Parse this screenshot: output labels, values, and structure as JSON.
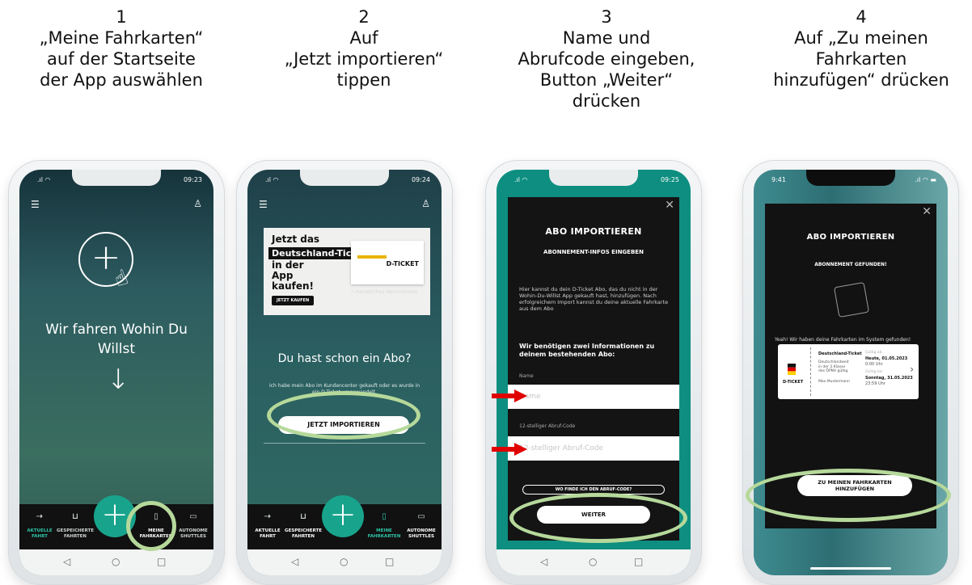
{
  "steps": [
    {
      "number": "1",
      "lines": [
        "„Meine Fahrkarten“",
        "auf der Startseite",
        "der App auswählen"
      ]
    },
    {
      "number": "2",
      "lines": [
        "Auf",
        "„Jetzt importieren“",
        "tippen"
      ]
    },
    {
      "number": "3",
      "lines": [
        "Name und",
        "Abrufcode eingeben,",
        "Button „Weiter“",
        "drücken"
      ]
    },
    {
      "number": "4",
      "lines": [
        "Auf „Zu meinen",
        "Fahrkarten",
        "hinzufügen“ drücken"
      ]
    }
  ],
  "phone1": {
    "time": "09:23",
    "hero_line1": "Wir fahren Wohin Du",
    "hero_line2": "Willst",
    "nav": [
      {
        "label": "AKTUELLE FAHRT",
        "icon": "route-icon"
      },
      {
        "label": "GESPEICHERTE FAHRTEN",
        "icon": "bookmark-icon"
      },
      {
        "label": "MEINE FAHRKARTEN",
        "icon": "ticket-phone-icon"
      },
      {
        "label": "AUTONOME SHUTTLES",
        "icon": "shuttle-icon"
      }
    ]
  },
  "phone2": {
    "time": "09:24",
    "ad_line1": "Jetzt das",
    "ad_highlight": "Deutschland-Ticket*",
    "ad_line3": "in der App kaufen!",
    "ad_button": "JETZT KAUFEN",
    "ad_card_label": "D-TICKET",
    "ad_note": "* monatliches Abonnement",
    "question": "Du hast schon ein Abo?",
    "subtext": "Ich habe mein Abo im Kundencenter gekauft oder es wurde in ein D-Ticket umgewandelt.",
    "import_button": "JETZT IMPORTIEREN",
    "nav": [
      {
        "label": "AKTUELLE FAHRT"
      },
      {
        "label": "GESPEICHERTE FAHRTEN"
      },
      {
        "label": "MEINE FAHRKARTEN"
      },
      {
        "label": "AUTONOME SHUTTLES"
      }
    ]
  },
  "phone3": {
    "time": "09:25",
    "title": "ABO IMPORTIEREN",
    "subtitle": "ABONNEMENT-INFOS EINGEBEN",
    "paragraph": "Hier kannst du dein D-Ticket Abo, das du nicht in der Wohin-Du-Willst App gekauft hast, hinzufügen. Nach erfolgreichem Import kannst du deine aktuelle Fahrkarte aus dem Abo",
    "info": "Wir benötigen zwei Informationen zu deinem bestehenden Abo:",
    "name_label": "Name",
    "name_placeholder": "Name",
    "code_label": "12-stelliger Abruf-Code",
    "code_placeholder": "12-stelliger Abruf-Code",
    "help_link": "WO FINDE ICH DEN ABRUF-CODE?",
    "next_button": "WEITER"
  },
  "phone4": {
    "time": "9:41",
    "title": "ABO IMPORTIEREN",
    "subtitle": "ABONNEMENT GEFUNDEN!",
    "message": "Yeah! Wir haben deine Fahrkarten im System gefunden!",
    "ticket": {
      "name": "Deutschland-Ticket",
      "desc": "Deutschlandweit in der 2.Klasse des ÖPNV gültig",
      "user": "Max Mustermann",
      "valid_from_label": "Gültig ab",
      "valid_from": "Heute, 01.05.2023",
      "valid_from_time": "0:00 Uhr",
      "valid_to_label": "Gültig bis",
      "valid_to": "Sonntag, 31.05.2023",
      "valid_to_time": "23:59 Uhr",
      "badge": "D-TICKET"
    },
    "add_button_line1": "ZU MEINEN FAHRKARTEN",
    "add_button_line2": "HINZUFÜGEN"
  },
  "colors": {
    "highlight_ring": "#b6d99b",
    "arrow": "#e00000",
    "accent": "#18a48c"
  }
}
